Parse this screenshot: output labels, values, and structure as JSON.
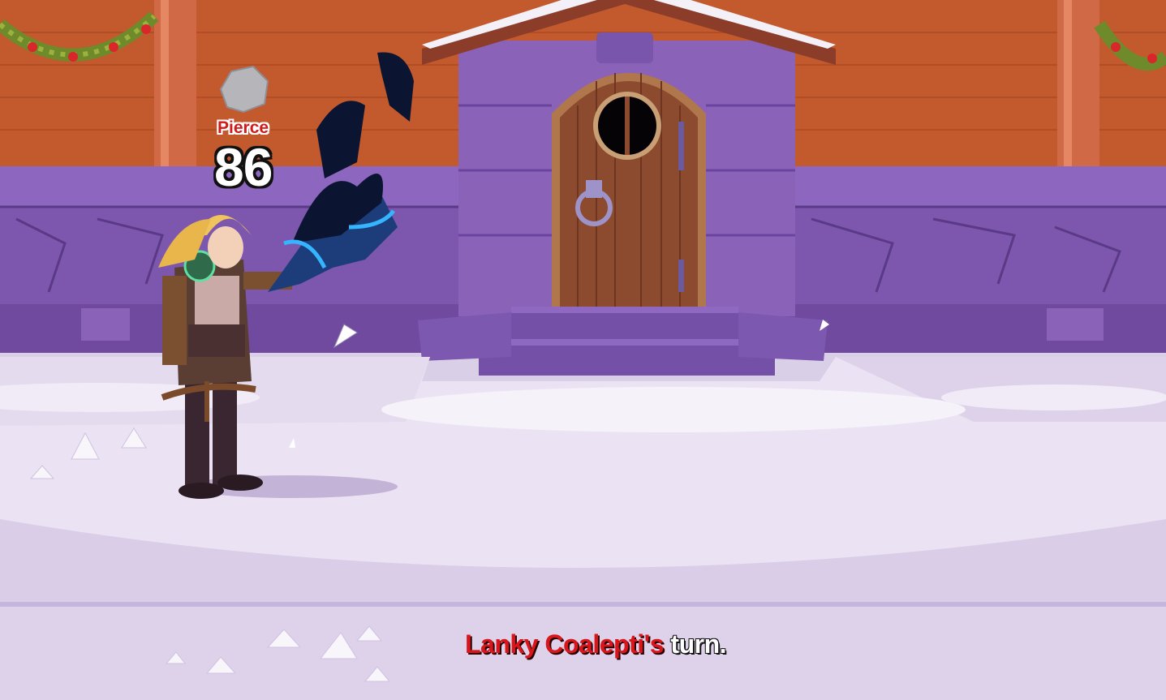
{
  "battle": {
    "damage_type": "Pierce",
    "damage_value": "86",
    "turn_message": {
      "name": "Lanky Coalepti's",
      "rest": " turn."
    }
  },
  "colors": {
    "brick_wall": "#c0552c",
    "stone_purple": "#8a62b8",
    "door_wood": "#8c4a2e",
    "snow": "#efe8f6",
    "damage_label": "#d11a1a",
    "turn_name": "#d8161b"
  },
  "icons": {
    "rock": "rock-icon",
    "cursor": "arrow-cursor-icon"
  }
}
